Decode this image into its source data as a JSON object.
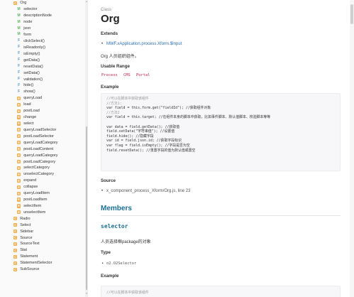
{
  "sidebar": {
    "items": [
      {
        "badge": "C",
        "label": "Org",
        "level": 0
      },
      {
        "badge": "M",
        "label": "selector",
        "level": 1
      },
      {
        "badge": "M",
        "label": "descriptionNode",
        "level": 1
      },
      {
        "badge": "M",
        "label": "node",
        "level": 1
      },
      {
        "badge": "M",
        "label": "json",
        "level": 1
      },
      {
        "badge": "M",
        "label": "form",
        "level": 1
      },
      {
        "badge": "F",
        "label": "clickSelect()",
        "level": 1
      },
      {
        "badge": "F",
        "label": "isReadonly()",
        "level": 1
      },
      {
        "badge": "F",
        "label": "isEmpty()",
        "level": 1
      },
      {
        "badge": "F",
        "label": "getData()",
        "level": 1
      },
      {
        "badge": "F",
        "label": "resetData()",
        "level": 1
      },
      {
        "badge": "F",
        "label": "setData()",
        "level": 1
      },
      {
        "badge": "F",
        "label": "validation()",
        "level": 1
      },
      {
        "badge": "F",
        "label": "hide()",
        "level": 1
      },
      {
        "badge": "F",
        "label": "show()",
        "level": 1
      },
      {
        "badge": "E",
        "label": "queryLoad",
        "level": 1
      },
      {
        "badge": "E",
        "label": "load",
        "level": 1
      },
      {
        "badge": "E",
        "label": "postLoad",
        "level": 1
      },
      {
        "badge": "E",
        "label": "change",
        "level": 1
      },
      {
        "badge": "E",
        "label": "select",
        "level": 1
      },
      {
        "badge": "E",
        "label": "queryLoadSelector",
        "level": 1
      },
      {
        "badge": "E",
        "label": "postLoadSelector",
        "level": 1
      },
      {
        "badge": "E",
        "label": "queryLoadCategory",
        "level": 1
      },
      {
        "badge": "E",
        "label": "postLoadContent",
        "level": 1
      },
      {
        "badge": "E",
        "label": "queryLoadCategory",
        "level": 1
      },
      {
        "badge": "E",
        "label": "postLoadCategory",
        "level": 1
      },
      {
        "badge": "E",
        "label": "selectCategory",
        "level": 1
      },
      {
        "badge": "E",
        "label": "unselectCategory",
        "level": 1
      },
      {
        "badge": "E",
        "label": "expand",
        "level": 1
      },
      {
        "badge": "E",
        "label": "collapse",
        "level": 1
      },
      {
        "badge": "E",
        "label": "queryLoadItem",
        "level": 1
      },
      {
        "badge": "E",
        "label": "postLoadItem",
        "level": 1
      },
      {
        "badge": "E",
        "label": "selectItem",
        "level": 1
      },
      {
        "badge": "E",
        "label": "unselectItem",
        "level": 1
      },
      {
        "badge": "C",
        "label": "Radio",
        "level": 0
      },
      {
        "badge": "C",
        "label": "Select",
        "level": 0
      },
      {
        "badge": "C",
        "label": "Sidebar",
        "level": 0
      },
      {
        "badge": "C",
        "label": "Source",
        "level": 0
      },
      {
        "badge": "C",
        "label": "SourceText",
        "level": 0
      },
      {
        "badge": "C",
        "label": "Stat",
        "level": 0
      },
      {
        "badge": "C",
        "label": "Statement",
        "level": 0
      },
      {
        "badge": "C",
        "label": "StatementSelector",
        "level": 0
      },
      {
        "badge": "C",
        "label": "SubSource",
        "level": 0
      }
    ]
  },
  "main": {
    "eyebrow": "Class",
    "title": "Org",
    "extends_label": "Extends",
    "extends_link": "MWF.xApplication.process.Xform.$Input",
    "description": "Org 人员组织组件。",
    "usable_range_label": "Usable Range",
    "usable_range_tags": [
      "Process",
      "CMS",
      "Portal"
    ],
    "example_label": "Example",
    "example_code": [
      {
        "cls": "c-com",
        "text": "//可以在脚本中获取该组件"
      },
      {
        "cls": "c-com",
        "text": "//方法1:"
      },
      {
        "cls": "",
        "text": "var field = this.form.get(\"fieldId\"); //获取组件对象"
      },
      {
        "cls": "c-com",
        "text": "//方法2"
      },
      {
        "cls": "",
        "text": "var field = this.target; //在组件本身的脚本中获取，比如事件脚本、默认值脚本、校验脚本等等"
      },
      {
        "cls": "",
        "text": ""
      },
      {
        "cls": "",
        "text": "var data = field.getData(); //获取值"
      },
      {
        "cls": "",
        "text": "field.setData(\"字符串值\"); //设置值"
      },
      {
        "cls": "",
        "text": "field.hide(); //隐藏字段"
      },
      {
        "cls": "",
        "text": "var id = field.json.id; //获取字段标识"
      },
      {
        "cls": "",
        "text": "var flag = field.isEmpty(); //字段是否为空"
      },
      {
        "cls": "",
        "text": "field.resetData(); //重置字段的值为默认值或置空"
      }
    ],
    "source_label": "Source",
    "source_value": "x_component_process_Xform/Org.js, line 23",
    "members_title": "Members",
    "member_name": "selector",
    "member_desc": "人员选择框package的对象",
    "type_label": "Type",
    "type_value": "o2.O2Selector",
    "example2_label": "Example",
    "example2_code": [
      {
        "cls": "c-com",
        "text": "//可以在脚本中获取该组件"
      }
    ]
  }
}
